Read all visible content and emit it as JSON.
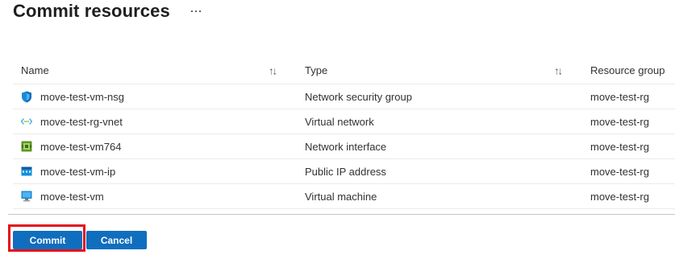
{
  "page": {
    "title": "Commit resources"
  },
  "table": {
    "columns": [
      {
        "label": "Name"
      },
      {
        "label": "Type"
      },
      {
        "label": "Resource group"
      }
    ],
    "rows": [
      {
        "name": "move-test-vm-nsg",
        "type": "Network security group",
        "resource_group": "move-test-rg",
        "icon": "shield-icon"
      },
      {
        "name": "move-test-rg-vnet",
        "type": "Virtual network",
        "resource_group": "move-test-rg",
        "icon": "vnet-icon"
      },
      {
        "name": "move-test-vm764",
        "type": "Network interface",
        "resource_group": "move-test-rg",
        "icon": "network-interface-icon"
      },
      {
        "name": "move-test-vm-ip",
        "type": "Public IP address",
        "resource_group": "move-test-rg",
        "icon": "public-ip-icon"
      },
      {
        "name": "move-test-vm",
        "type": "Virtual machine",
        "resource_group": "move-test-rg",
        "icon": "virtual-machine-icon"
      }
    ]
  },
  "actions": {
    "commit_label": "Commit",
    "cancel_label": "Cancel"
  },
  "colors": {
    "primary_button": "#106ebe",
    "highlight": "#e3101b"
  }
}
